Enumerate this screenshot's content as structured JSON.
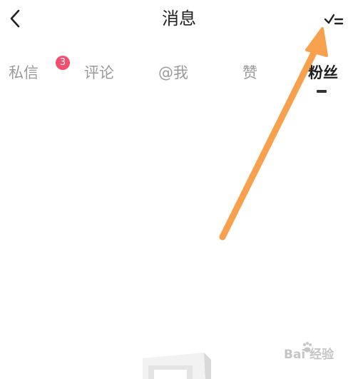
{
  "header": {
    "title": "消息",
    "back_icon": "chevron-left-icon",
    "mark_read_icon": "check-list-icon"
  },
  "tabs": [
    {
      "label": "私信",
      "badge": "3",
      "active": false
    },
    {
      "label": "评论",
      "active": false
    },
    {
      "label": "@我",
      "active": false
    },
    {
      "label": "赞",
      "active": false
    },
    {
      "label": "粉丝",
      "active": true
    }
  ],
  "annotation": {
    "arrow_color": "#f7a04d"
  },
  "watermark": {
    "text": "Bai 经验"
  },
  "colors": {
    "badge": "#f0506e",
    "active_tab": "#1f1f1f",
    "inactive_tab": "#9a9a9a"
  }
}
